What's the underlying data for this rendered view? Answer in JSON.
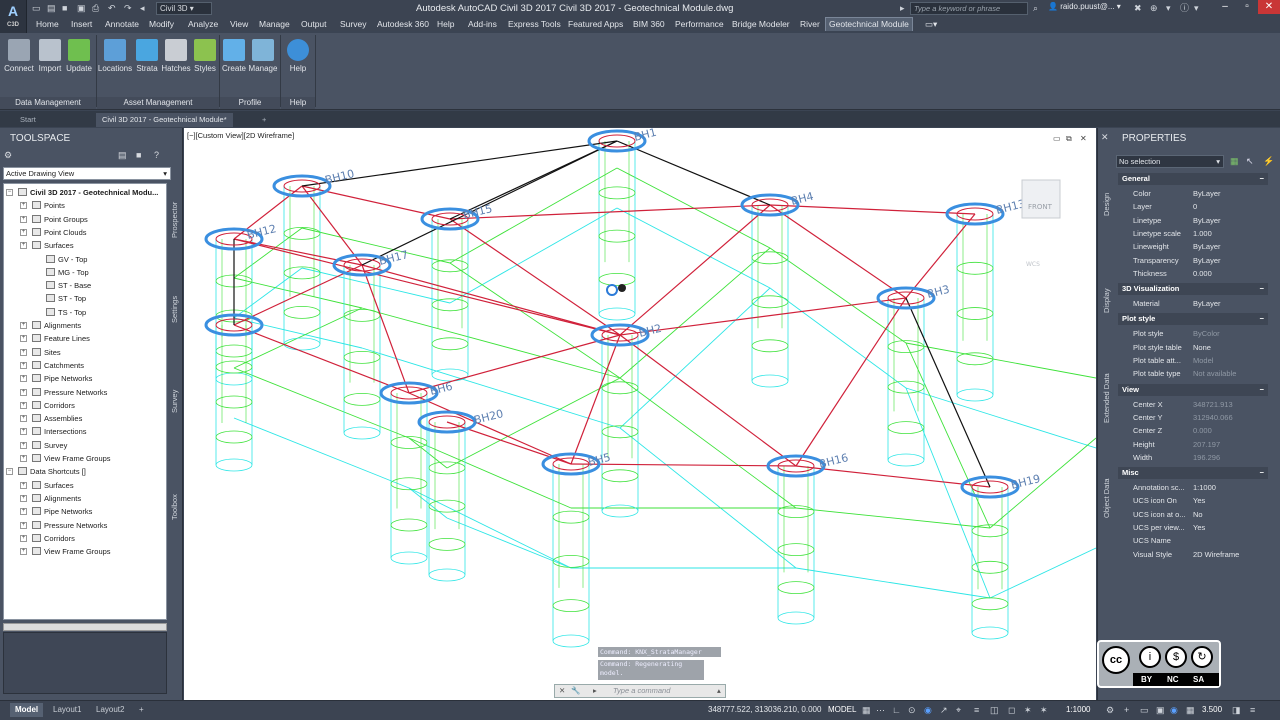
{
  "app": {
    "title": "Autodesk AutoCAD Civil 3D 2017    Civil 3D 2017 - Geotechnical Module.dwg",
    "app_icon_label": "A",
    "app_icon_sub": "C3D",
    "workspace": "Civil 3D",
    "search_placeholder": "Type a keyword or phrase",
    "user": "raido.puust@..."
  },
  "menu": [
    "Home",
    "Insert",
    "Annotate",
    "Modify",
    "Analyze",
    "View",
    "Manage",
    "Output",
    "Survey",
    "Autodesk 360",
    "Help",
    "Add-ins",
    "Express Tools",
    "Featured Apps",
    "BIM 360",
    "Performance",
    "Bridge Modeler",
    "River",
    "Geotechnical Module"
  ],
  "ribbon": {
    "buttons": [
      {
        "label": "Connect",
        "icon": "connect-icon",
        "color": "#9aa5b3"
      },
      {
        "label": "Import",
        "icon": "import-icon",
        "color": "#b9c2cd"
      },
      {
        "label": "Update",
        "icon": "update-icon",
        "color": "#6fbf4f"
      },
      {
        "label": "Locations",
        "icon": "locations-icon",
        "color": "#5d9fd8"
      },
      {
        "label": "Strata",
        "icon": "strata-icon",
        "color": "#4aa6e0"
      },
      {
        "label": "Hatches",
        "icon": "hatches-icon",
        "color": "#c9cdd3"
      },
      {
        "label": "Styles",
        "icon": "styles-icon",
        "color": "#8cc24f"
      },
      {
        "label": "Create",
        "icon": "create-icon",
        "color": "#62b0e8"
      },
      {
        "label": "Manage",
        "icon": "manage-icon",
        "color": "#7fb4d8"
      },
      {
        "label": "Help",
        "icon": "help-icon",
        "color": "#3d8fd8"
      }
    ],
    "panels": [
      "Data Management",
      "Asset Management",
      "Profile",
      "Help"
    ]
  },
  "file_tabs": [
    "Start",
    "Civil 3D 2017 - Geotechnical Module*",
    "+"
  ],
  "toolspace": {
    "title": "TOOLSPACE",
    "view_select": "Active Drawing View",
    "tree": [
      {
        "label": "Civil 3D 2017 - Geotechnical Modu...",
        "level": 0,
        "bold": true
      },
      {
        "label": "Points",
        "level": 1
      },
      {
        "label": "Point Groups",
        "level": 1
      },
      {
        "label": "Point Clouds",
        "level": 1
      },
      {
        "label": "Surfaces",
        "level": 1
      },
      {
        "label": "GV - Top",
        "level": 2
      },
      {
        "label": "MG - Top",
        "level": 2
      },
      {
        "label": "ST - Base",
        "level": 2
      },
      {
        "label": "ST - Top",
        "level": 2
      },
      {
        "label": "TS - Top",
        "level": 2
      },
      {
        "label": "Alignments",
        "level": 1
      },
      {
        "label": "Feature Lines",
        "level": 1
      },
      {
        "label": "Sites",
        "level": 1
      },
      {
        "label": "Catchments",
        "level": 1
      },
      {
        "label": "Pipe Networks",
        "level": 1
      },
      {
        "label": "Pressure Networks",
        "level": 1
      },
      {
        "label": "Corridors",
        "level": 1
      },
      {
        "label": "Assemblies",
        "level": 1
      },
      {
        "label": "Intersections",
        "level": 1
      },
      {
        "label": "Survey",
        "level": 1
      },
      {
        "label": "View Frame Groups",
        "level": 1
      },
      {
        "label": "Data Shortcuts []",
        "level": 0,
        "bold": false
      },
      {
        "label": "Surfaces",
        "level": 1
      },
      {
        "label": "Alignments",
        "level": 1
      },
      {
        "label": "Pipe Networks",
        "level": 1
      },
      {
        "label": "Pressure Networks",
        "level": 1
      },
      {
        "label": "Corridors",
        "level": 1
      },
      {
        "label": "View Frame Groups",
        "level": 1
      }
    ],
    "side_tabs": [
      "Prospector",
      "Settings",
      "Survey",
      "Toolbox"
    ]
  },
  "viewport": {
    "label": "[−][Custom View][2D Wireframe]",
    "viewcube_face": "FRONT",
    "wcs": "WCS",
    "boreholes": [
      "BH10",
      "BH12",
      "BH17",
      "BH15",
      "BH4",
      "BH13",
      "BH1",
      "BH3",
      "BH2",
      "BH6",
      "BH20",
      "BH5",
      "BH16",
      "BH19"
    ]
  },
  "command": {
    "history1": "Command: KNX_StrataManager",
    "history2": "Command:  Regenerating model.",
    "placeholder": "Type a command"
  },
  "properties": {
    "title": "PROPERTIES",
    "selection": "No selection",
    "side_tabs_left": [
      "Design",
      "Display",
      "Extended Data",
      "Object Data"
    ],
    "sections": [
      {
        "name": "General",
        "rows": [
          {
            "k": "Color",
            "v": "ByLayer"
          },
          {
            "k": "Layer",
            "v": "0"
          },
          {
            "k": "Linetype",
            "v": "ByLayer"
          },
          {
            "k": "Linetype scale",
            "v": "1.000"
          },
          {
            "k": "Lineweight",
            "v": "ByLayer"
          },
          {
            "k": "Transparency",
            "v": "ByLayer"
          },
          {
            "k": "Thickness",
            "v": "0.000"
          }
        ]
      },
      {
        "name": "3D Visualization",
        "rows": [
          {
            "k": "Material",
            "v": "ByLayer"
          }
        ]
      },
      {
        "name": "Plot style",
        "rows": [
          {
            "k": "Plot style",
            "v": "ByColor",
            "dim": true
          },
          {
            "k": "Plot style table",
            "v": "None"
          },
          {
            "k": "Plot table att...",
            "v": "Model",
            "dim": true
          },
          {
            "k": "Plot table type",
            "v": "Not available",
            "dim": true
          }
        ]
      },
      {
        "name": "View",
        "rows": [
          {
            "k": "Center X",
            "v": "348721.913",
            "dim": true
          },
          {
            "k": "Center Y",
            "v": "312940.066",
            "dim": true
          },
          {
            "k": "Center Z",
            "v": "0.000",
            "dim": true
          },
          {
            "k": "Height",
            "v": "207.197",
            "dim": true
          },
          {
            "k": "Width",
            "v": "196.296",
            "dim": true
          }
        ]
      },
      {
        "name": "Misc",
        "rows": [
          {
            "k": "Annotation sc...",
            "v": "1:1000"
          },
          {
            "k": "UCS icon On",
            "v": "Yes"
          },
          {
            "k": "UCS icon at o...",
            "v": "No"
          },
          {
            "k": "UCS per view...",
            "v": "Yes"
          },
          {
            "k": "UCS Name",
            "v": ""
          },
          {
            "k": "Visual Style",
            "v": "2D Wireframe"
          }
        ]
      }
    ]
  },
  "license_badge": {
    "items": [
      "BY",
      "NC",
      "SA"
    ]
  },
  "status": {
    "tabs": [
      "Model",
      "Layout1",
      "Layout2",
      "+"
    ],
    "coords": "348777.522, 313036.210, 0.000",
    "mode": "MODEL",
    "scale": "1:1000",
    "value": "3.500"
  }
}
